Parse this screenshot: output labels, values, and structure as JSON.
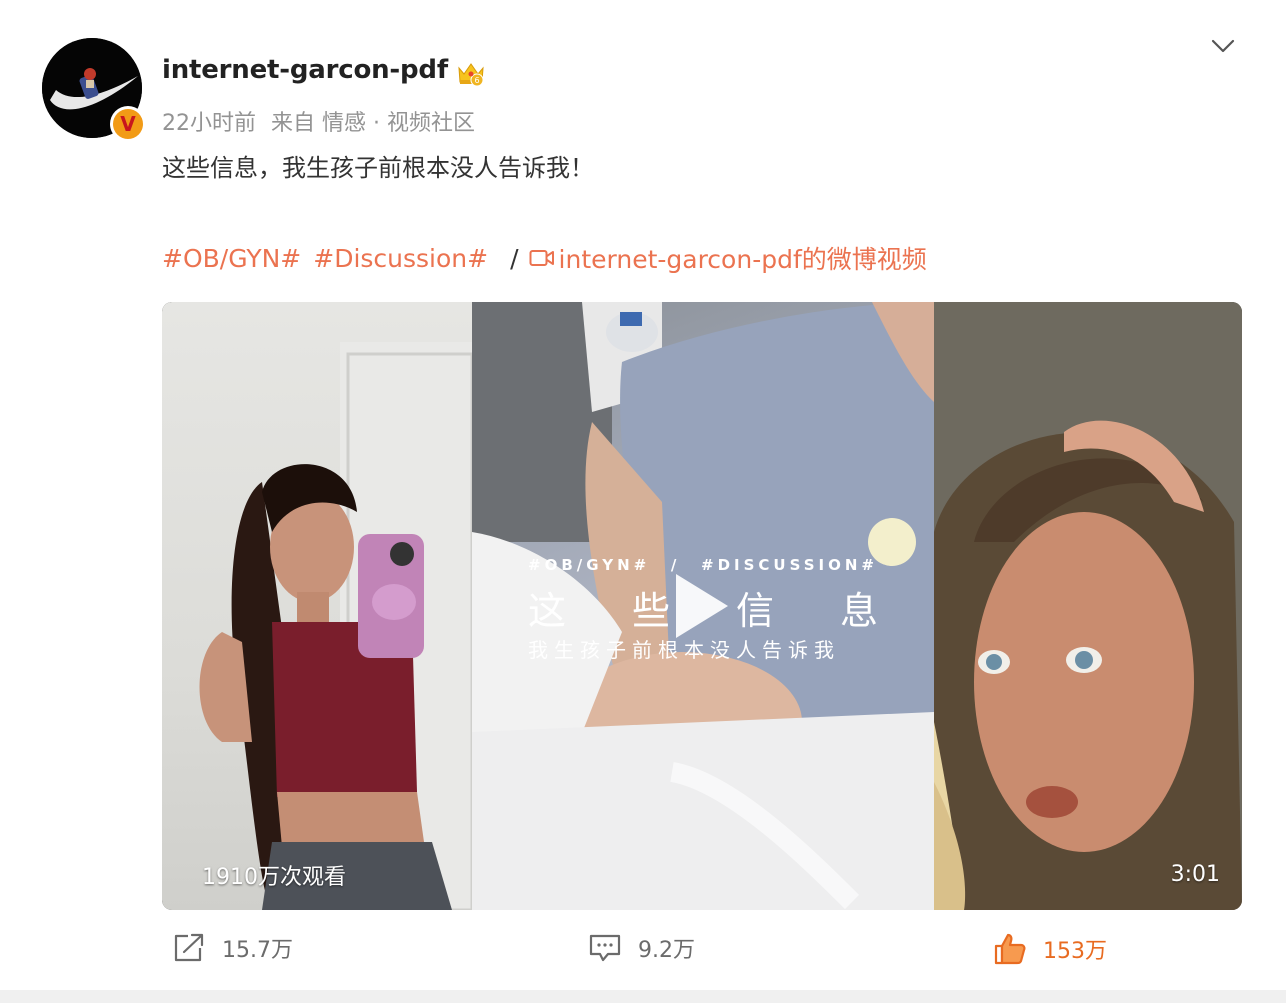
{
  "post": {
    "username": "internet-garcon-pdf",
    "meta": {
      "time": "22小时前",
      "source": "来自 情感 · 视频社区"
    },
    "text": "这些信息，我生孩子前根本没人告诉我！",
    "tags": [
      "#OB/GYN#",
      "#Discussion#"
    ],
    "separator": "/",
    "video_link": "internet-garcon-pdf的微博视频"
  },
  "video": {
    "overlay_tags_left": "#OB/GYN#",
    "overlay_tags_mid": "/",
    "overlay_tags_right": "#DISCUSSION#",
    "overlay_title": [
      "这",
      "些",
      "信",
      "息"
    ],
    "overlay_subtitle": "我生孩子前根本没人告诉我",
    "views": "1910万次观看",
    "duration": "3:01"
  },
  "actions": {
    "repost": "15.7万",
    "comment": "9.2万",
    "like": "153万"
  },
  "colors": {
    "accent": "#eb7350",
    "like": "#e86b21",
    "muted": "#939393"
  },
  "icons": [
    "crown-icon",
    "verified-icon",
    "chevron-down-icon",
    "video-icon",
    "play-icon",
    "repost-icon",
    "comment-icon",
    "like-icon"
  ]
}
